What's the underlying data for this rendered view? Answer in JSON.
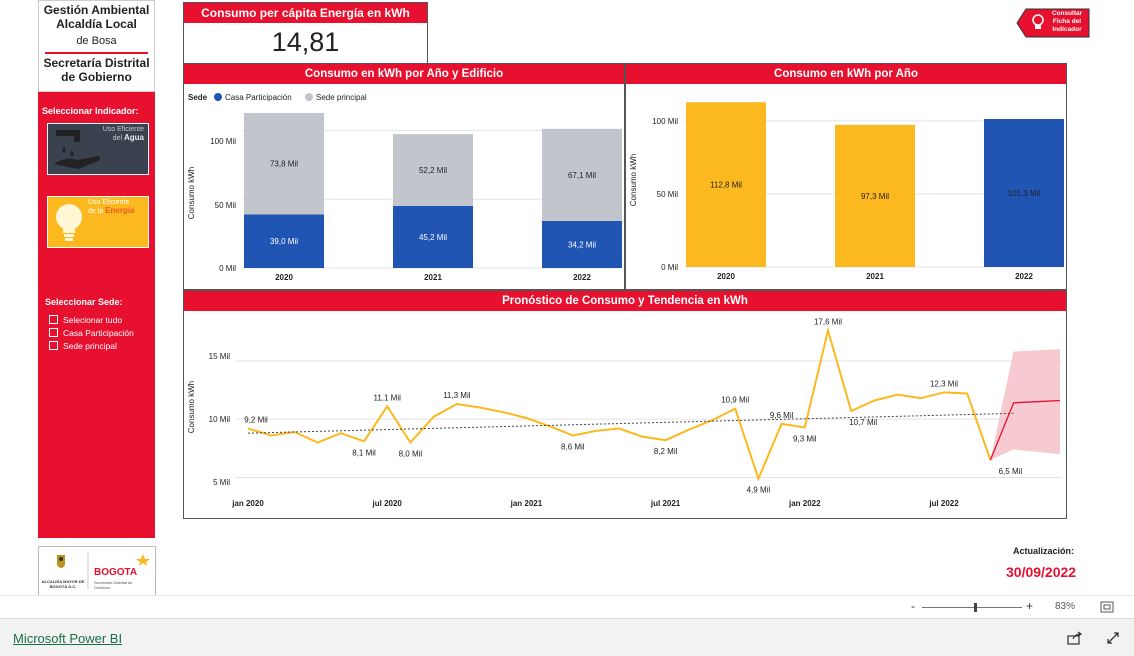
{
  "sidebar": {
    "org_lines": [
      "Gestión Ambiental",
      "Alcaldía Local",
      "de Bosa",
      "Secretaría Distrital",
      "de Gobierno"
    ],
    "select_indicator_label": "Seleccionar Indicador:",
    "tiles": [
      {
        "line1": "Uso Eficiente",
        "line2": "del",
        "line3": "Agua",
        "icon": "water-hand-icon"
      },
      {
        "line1": "Uso Eficiente",
        "line2": "de la",
        "line3": "Energía",
        "icon": "lightbulb-icon"
      }
    ],
    "select_sede_label": "Seleccionar Sede:",
    "sede_options": [
      "Selecionar tudo",
      "Casa Participación",
      "Sede principal"
    ],
    "logo_left_text": "ALCALDÍA MAYOR DE BOGOTÁ D.C.",
    "logo_right_text": "BOGOTA",
    "logo_right_sub": "Secretaría Distrital de Gobierno"
  },
  "kpi": {
    "title": "Consumo per cápita Energía en kWh",
    "value": "14,81"
  },
  "consult_button": {
    "lines": [
      "Consultar",
      "Ficha del",
      "Indicador"
    ]
  },
  "colors": {
    "red": "#e8102f",
    "blue": "#2055b3",
    "gray": "#c2c6cc",
    "yellow": "#fbb81f",
    "pink": "#f6c4cc"
  },
  "chart1": {
    "title": "Consumo en kWh por Año y Edificio",
    "legend_title": "Sede",
    "legend": [
      "Casa Participación",
      "Sede principal"
    ],
    "ylabel": "Consumo kWh",
    "yticks": [
      "0 Mil",
      "50 Mil",
      "100 Mil"
    ]
  },
  "chart2": {
    "title": "Consumo en kWh por Año",
    "ylabel": "Consumo kWh",
    "yticks": [
      "0 Mil",
      "50 Mil",
      "100 Mil"
    ]
  },
  "chart3": {
    "title": "Pronóstico de Consumo y Tendencia en kWh",
    "ylabel": "Consumo kWh",
    "yticks": [
      "5 Mil",
      "10 Mil",
      "15 Mil"
    ],
    "xticks": [
      "jan 2020",
      "jul 2020",
      "jan 2021",
      "jul 2021",
      "jan 2022",
      "jul 2022"
    ]
  },
  "chart_data": [
    {
      "type": "bar",
      "title": "Consumo en kWh por Año y Edificio",
      "categories": [
        "2020",
        "2021",
        "2022"
      ],
      "ylim": [
        0,
        115
      ],
      "series": [
        {
          "name": "Casa Participación",
          "color": "#2055b3",
          "values": [
            39.0,
            45.2,
            34.2
          ],
          "labels": [
            "39,0 Mil",
            "45,2 Mil",
            "34,2 Mil"
          ]
        },
        {
          "name": "Sede principal",
          "color": "#c2c6cc",
          "values": [
            73.8,
            52.2,
            67.1
          ],
          "labels": [
            "73,8 Mil",
            "52,2 Mil",
            "67,1 Mil"
          ]
        }
      ]
    },
    {
      "type": "bar",
      "title": "Consumo en kWh por Año",
      "categories": [
        "2020",
        "2021",
        "2022"
      ],
      "ylim": [
        0,
        115
      ],
      "values": [
        112.8,
        97.3,
        101.3
      ],
      "labels": [
        "112,8 Mil",
        "97,3 Mil",
        "101,3 Mil"
      ],
      "bar_colors": [
        "#fbb81f",
        "#fbb81f",
        "#2055b3"
      ]
    },
    {
      "type": "line",
      "title": "Pronóstico de Consumo y Tendencia en kWh",
      "x": [
        "2020-01",
        "2020-02",
        "2020-03",
        "2020-04",
        "2020-05",
        "2020-06",
        "2020-07",
        "2020-08",
        "2020-09",
        "2020-10",
        "2020-11",
        "2020-12",
        "2021-01",
        "2021-02",
        "2021-03",
        "2021-04",
        "2021-05",
        "2021-06",
        "2021-07",
        "2021-08",
        "2021-09",
        "2021-10",
        "2021-11",
        "2021-12",
        "2022-01",
        "2022-02",
        "2022-03",
        "2022-04",
        "2022-05",
        "2022-06",
        "2022-07",
        "2022-08",
        "2022-09"
      ],
      "y": [
        9.2,
        8.6,
        8.9,
        8.0,
        8.8,
        8.1,
        11.1,
        8.0,
        10.2,
        11.3,
        11.0,
        10.6,
        10.1,
        9.4,
        8.6,
        9.0,
        9.2,
        8.5,
        8.2,
        9.1,
        9.9,
        10.9,
        4.9,
        9.6,
        9.3,
        17.6,
        10.7,
        11.6,
        12.1,
        11.8,
        12.3,
        12.2,
        6.5
      ],
      "labels": {
        "0": "9,2 Mil",
        "5": "8,1 Mil",
        "6": "11,1 Mil",
        "7": "8,0 Mil",
        "9": "11,3 Mil",
        "14": "8,6 Mil",
        "18": "8,2 Mil",
        "21": "10,9 Mil",
        "22": "4,9 Mil",
        "23": "9,6 Mil",
        "24": "9,3 Mil",
        "25": "17,6 Mil",
        "26": "10,7 Mil",
        "30": "12,3 Mil",
        "32": "6,5 Mil"
      },
      "trend": {
        "start": 8.8,
        "end": 10.5
      },
      "forecast": {
        "x": [
          "2022-09",
          "2022-10",
          "2022-11",
          "2022-12"
        ],
        "y": [
          6.5,
          11.4,
          11.5,
          11.6
        ],
        "lower": [
          6.5,
          7.4,
          7.2,
          7.0
        ],
        "upper": [
          6.5,
          15.8,
          15.9,
          16.0
        ]
      },
      "ylim": [
        3.5,
        18.5
      ]
    }
  ],
  "update": {
    "label": "Actualización:",
    "date": "30/09/2022"
  },
  "zoom": {
    "minus": "-",
    "plus": "+",
    "percent": "83%",
    "level": 0.53
  },
  "footer": {
    "link": "Microsoft Power BI"
  }
}
